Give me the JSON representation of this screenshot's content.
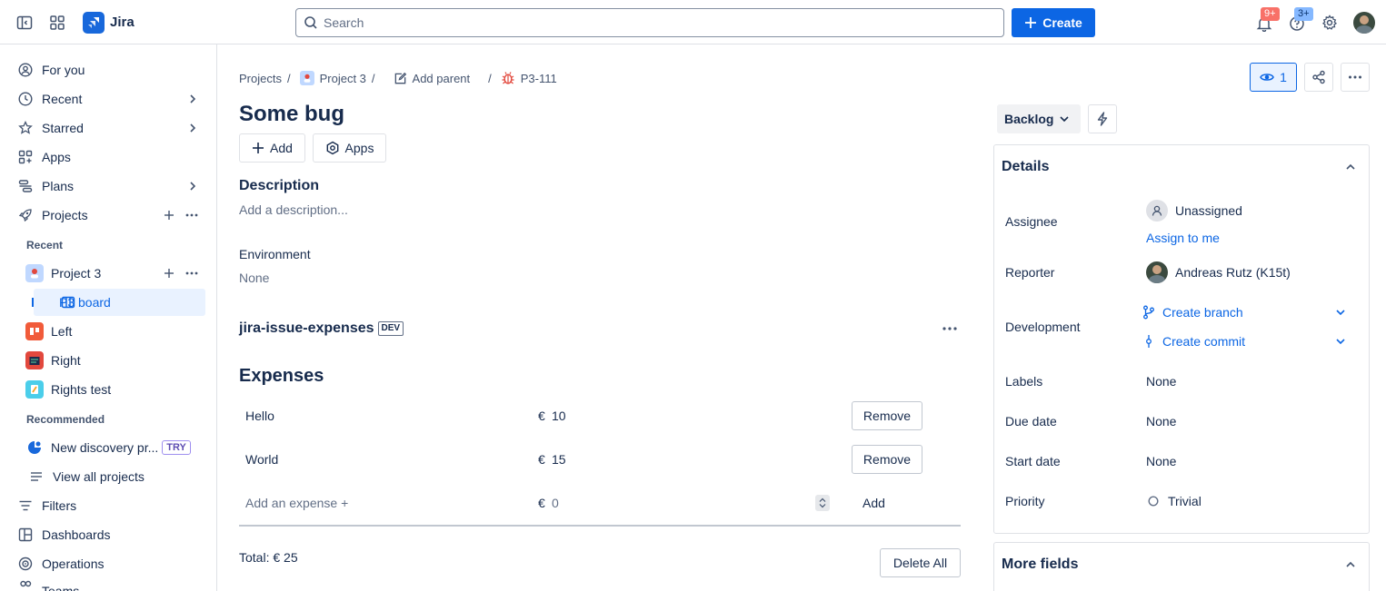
{
  "topbar": {
    "app_name": "Jira",
    "search_placeholder": "Search",
    "create_label": "Create",
    "notifications_badge": "9+",
    "help_badge": "3+"
  },
  "sidebar": {
    "for_you": "For you",
    "recent": "Recent",
    "starred": "Starred",
    "apps": "Apps",
    "plans": "Plans",
    "projects": "Projects",
    "recent_heading": "Recent",
    "project3": "Project 3",
    "p3_board": "P3 board",
    "left": "Left",
    "right": "Right",
    "rights_test": "Rights test",
    "recommended_heading": "Recommended",
    "new_discovery": "New discovery pr...",
    "try_badge": "TRY",
    "view_all_projects": "View all projects",
    "filters": "Filters",
    "dashboards": "Dashboards",
    "operations": "Operations",
    "teams": "Teams"
  },
  "breadcrumb": {
    "projects": "Projects",
    "project3": "Project 3",
    "add_parent": "Add parent",
    "issue_key": "P3-111",
    "sep": "/"
  },
  "issue": {
    "title": "Some bug",
    "add_label": "Add",
    "apps_label": "Apps",
    "description_heading": "Description",
    "description_placeholder": "Add a description...",
    "environment_label": "Environment",
    "environment_value": "None",
    "watchers_count": "1"
  },
  "app_panel": {
    "name": "jira-issue-expenses",
    "badge": "DEV",
    "expenses_heading": "Expenses",
    "currency": "€",
    "rows": [
      {
        "name": "Hello",
        "amount": "10",
        "action": "Remove"
      },
      {
        "name": "World",
        "amount": "15",
        "action": "Remove"
      }
    ],
    "new_name_placeholder": "Add an expense +",
    "new_amount": "0",
    "add_label": "Add",
    "total": "Total: € 25",
    "delete_all": "Delete All"
  },
  "status": {
    "value": "Backlog"
  },
  "details": {
    "heading": "Details",
    "assignee_label": "Assignee",
    "assignee_value": "Unassigned",
    "assign_to_me": "Assign to me",
    "reporter_label": "Reporter",
    "reporter_value": "Andreas Rutz (K15t)",
    "development_label": "Development",
    "create_branch": "Create branch",
    "create_commit": "Create commit",
    "labels_label": "Labels",
    "labels_value": "None",
    "due_date_label": "Due date",
    "due_date_value": "None",
    "start_date_label": "Start date",
    "start_date_value": "None",
    "priority_label": "Priority",
    "priority_value": "Trivial"
  },
  "more_fields": {
    "heading": "More fields"
  },
  "colors": {
    "brand_blue": "#0c66e4",
    "selected_bg": "#e9f2ff",
    "notif_badge": "#f87168",
    "help_badge": "#579dff"
  }
}
